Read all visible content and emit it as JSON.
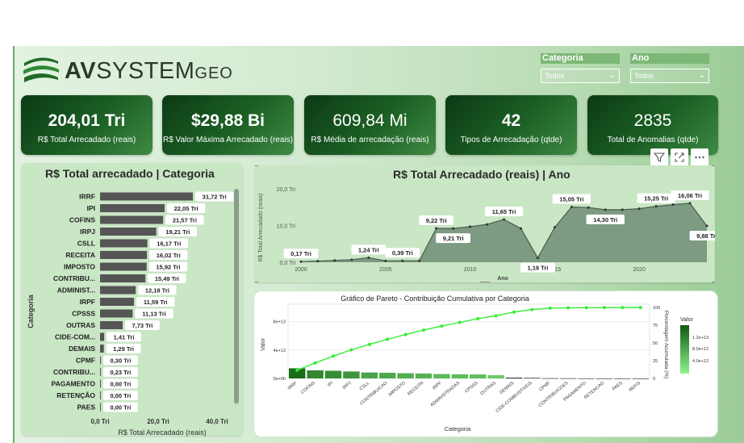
{
  "brand": {
    "name_bold": "AV",
    "name_rest": "SYSTEM",
    "name_suffix": "GEO"
  },
  "colors": {
    "kpi_dark": "#0c3a14",
    "kpi_light": "#3e8a43",
    "bar": "#555555",
    "area": "#7d9a82",
    "pareto_line": "#33ee33",
    "pareto_bar_dark": "#1a6b1a"
  },
  "slicers": [
    {
      "title": "Categoria",
      "value": "Todos"
    },
    {
      "title": "Ano",
      "value": "Todos"
    }
  ],
  "kpis": [
    {
      "value": "204,01 Tri",
      "label": "R$ Total Arrecadado (reais)"
    },
    {
      "value": "$29,88 Bi",
      "label": "R$ Valor Máxima Arrecadado (reais)"
    },
    {
      "value": "609,84 Mi",
      "label": "R$ Média de arrecadação (reais)"
    },
    {
      "value": "42",
      "label": "Tipos de Arrecadação (qtde)"
    },
    {
      "value": "2835",
      "label": "Total de Anomalias (qtde)"
    }
  ],
  "visual_icons": [
    "filter-icon",
    "focus-mode-icon",
    "more-options-icon"
  ],
  "chart_data": [
    {
      "type": "bar",
      "orientation": "horizontal",
      "title": "R$ Total arrecadado | Categoria",
      "xlabel": "R$ Total Arrecadado (reais)",
      "ylabel": "Categoria",
      "xlim": [
        0,
        40
      ],
      "xticks": [
        "0,0 Tri",
        "20,0 Tri",
        "40,0 Tri"
      ],
      "categories": [
        "IRRF",
        "IPI",
        "COFINS",
        "IRPJ",
        "CSLL",
        "RECEITA",
        "IMPOSTO",
        "CONTRIBU...",
        "ADMINIST...",
        "IRPF",
        "CPSSS",
        "OUTRAS",
        "CIDE-COM...",
        "DEMAIS",
        "CPMF",
        "CONTRIBU...",
        "PAGAMENTO",
        "RETENÇÃO",
        "PAES"
      ],
      "values": [
        31.72,
        22.05,
        21.57,
        19.21,
        16.17,
        16.02,
        15.92,
        15.49,
        12.18,
        11.59,
        11.13,
        7.73,
        1.41,
        1.29,
        0.3,
        0.23,
        0.0,
        0.0,
        0.0
      ],
      "labels": [
        "31,72 Tri",
        "22,05 Tri",
        "21,57 Tri",
        "19,21 Tri",
        "16,17 Tri",
        "16,02 Tri",
        "15,92 Tri",
        "15,49 Tri",
        "12,18 Tri",
        "11,59 Tri",
        "11,13 Tri",
        "7,73 Tri",
        "1,41 Tri",
        "1,29 Tri",
        "0,30 Tri",
        "0,23 Tri",
        "0,00 Tri",
        "0,00 Tri",
        "0,00 Tri"
      ]
    },
    {
      "type": "area",
      "title": "R$ Total Arrecadado (reais) | Ano",
      "xlabel": "Ano",
      "ylabel": "R$ Total Arrecadado (reais)",
      "ylim": [
        0,
        20
      ],
      "yticks": [
        "0,0 Tri",
        "10,0 Tri",
        "20,0 Tri"
      ],
      "xticks": [
        "2000",
        "2005",
        "2010",
        "2015",
        "2020"
      ],
      "x": [
        2000,
        2001,
        2002,
        2003,
        2004,
        2005,
        2006,
        2007,
        2008,
        2009,
        2010,
        2011,
        2012,
        2013,
        2014,
        2015,
        2016,
        2017,
        2018,
        2019,
        2020,
        2021,
        2022,
        2023,
        2024
      ],
      "y": [
        0.17,
        0.3,
        0.5,
        0.7,
        1.24,
        0.39,
        0.39,
        0.39,
        9.22,
        9.21,
        9.7,
        10.3,
        11.65,
        9.2,
        1.19,
        9.5,
        15.05,
        14.9,
        14.3,
        14.3,
        14.6,
        15.25,
        15.7,
        16.06,
        9.88
      ],
      "data_labels": [
        {
          "x": 2000,
          "text": "0,17 Tri"
        },
        {
          "x": 2004,
          "text": "1,24 Tri"
        },
        {
          "x": 2006,
          "text": "0,39 Tri"
        },
        {
          "x": 2008,
          "text": "9,22 Tri"
        },
        {
          "x": 2009,
          "text": "9,21 Tri"
        },
        {
          "x": 2012,
          "text": "11,65 Tri"
        },
        {
          "x": 2014,
          "text": "1,19 Tri"
        },
        {
          "x": 2016,
          "text": "15,05 Tri"
        },
        {
          "x": 2018,
          "text": "14,30 Tri"
        },
        {
          "x": 2021,
          "text": "15,25 Tri"
        },
        {
          "x": 2023,
          "text": "16,06 Tri"
        },
        {
          "x": 2024,
          "text": "9,88 Tri"
        }
      ]
    },
    {
      "type": "bar",
      "title": "Gráfico de Pareto - Contribuição Cumulativa por Categoria",
      "xlabel": "Categoria",
      "ylabel": "Valor",
      "y2label": "Porcentagem Acumulada (%)",
      "legend_title": "Valor",
      "legend_ticks": [
        "1.2e+13",
        "8.0e+12",
        "4.0e+12"
      ],
      "yticks": [
        "0e+00",
        "4e+13",
        "8e+13"
      ],
      "y2ticks": [
        "0",
        "25",
        "50",
        "75",
        "100"
      ],
      "ylim": [
        0,
        100000000000000.0
      ],
      "y2lim": [
        0,
        100
      ],
      "categories": [
        "IRRF",
        "COFINS",
        "IPI",
        "IRPJ",
        "CSLL",
        "CONTRIBUICAO",
        "IMPOSTO",
        "RECEITA",
        "IRPF",
        "ADMINISTRADAS",
        "CPSSS",
        "OUTRAS",
        "DEMAIS",
        "CIDE-COMBUSTIVEIS",
        "CPMF",
        "CONTRIBUICOES",
        "PAGAMENTO",
        "RETENCAO",
        "PAES",
        "REFIS"
      ],
      "values": [
        14300000000000.0,
        11400000000000.0,
        10800000000000.0,
        9800000000000.0,
        8400000000000.0,
        8000000000000.0,
        7400000000000.0,
        7000000000000.0,
        6200000000000.0,
        5900000000000.0,
        5700000000000.0,
        4600000000000.0,
        1100000000000.0,
        800000000000.0,
        300000000000.0,
        200000000000.0,
        100000000000.0,
        50000000000.0,
        30000000000.0,
        10000000000.0
      ],
      "cumulative_pct": [
        11.6,
        21.8,
        31.5,
        40.3,
        47.9,
        55.1,
        61.8,
        68.1,
        73.7,
        79.0,
        84.2,
        88.3,
        93.5,
        97.0,
        99.0,
        99.5,
        99.7,
        99.8,
        99.9,
        100
      ]
    }
  ]
}
